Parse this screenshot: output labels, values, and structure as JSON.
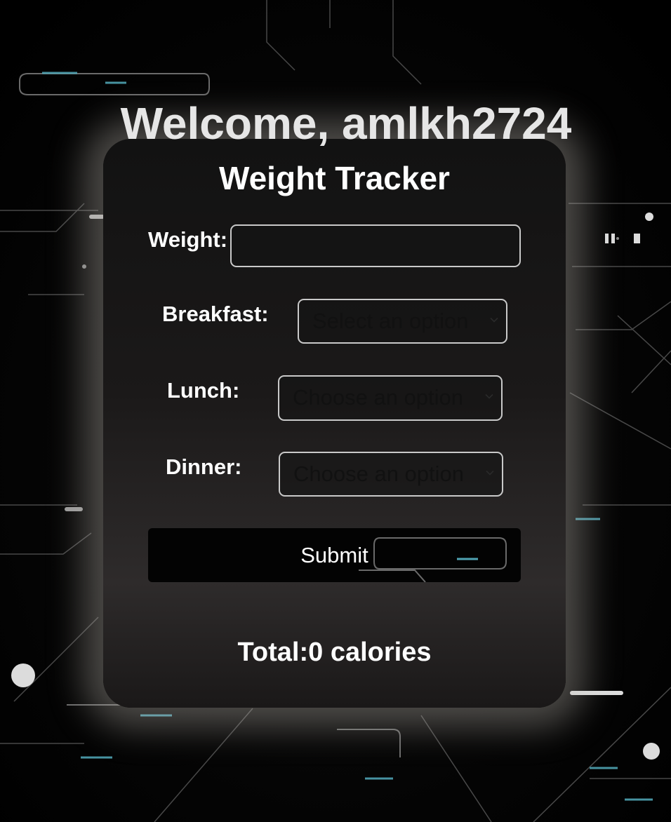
{
  "header": {
    "welcome_prefix": "Welcome, ",
    "username": "amlkh2724"
  },
  "tracker": {
    "title": "Weight Tracker",
    "weight_label": "Weight:",
    "weight_value": "",
    "breakfast_label": "Breakfast:",
    "breakfast_selected": "Select an option",
    "lunch_label": "Lunch:",
    "lunch_selected": "Choose an option",
    "dinner_label": "Dinner:",
    "dinner_selected": "Choose an option",
    "submit_label": "Submit",
    "total_prefix": "Total:",
    "total_value": "0",
    "total_unit": " calories"
  },
  "icons": {
    "select_arrow": "chevron-down-icon"
  },
  "colors": {
    "page_background": "#000000",
    "card_background": "#1b1919",
    "text": "#ffffff",
    "field_border": "#c9c9c9",
    "circuit_accent": "#4fa3b3"
  }
}
